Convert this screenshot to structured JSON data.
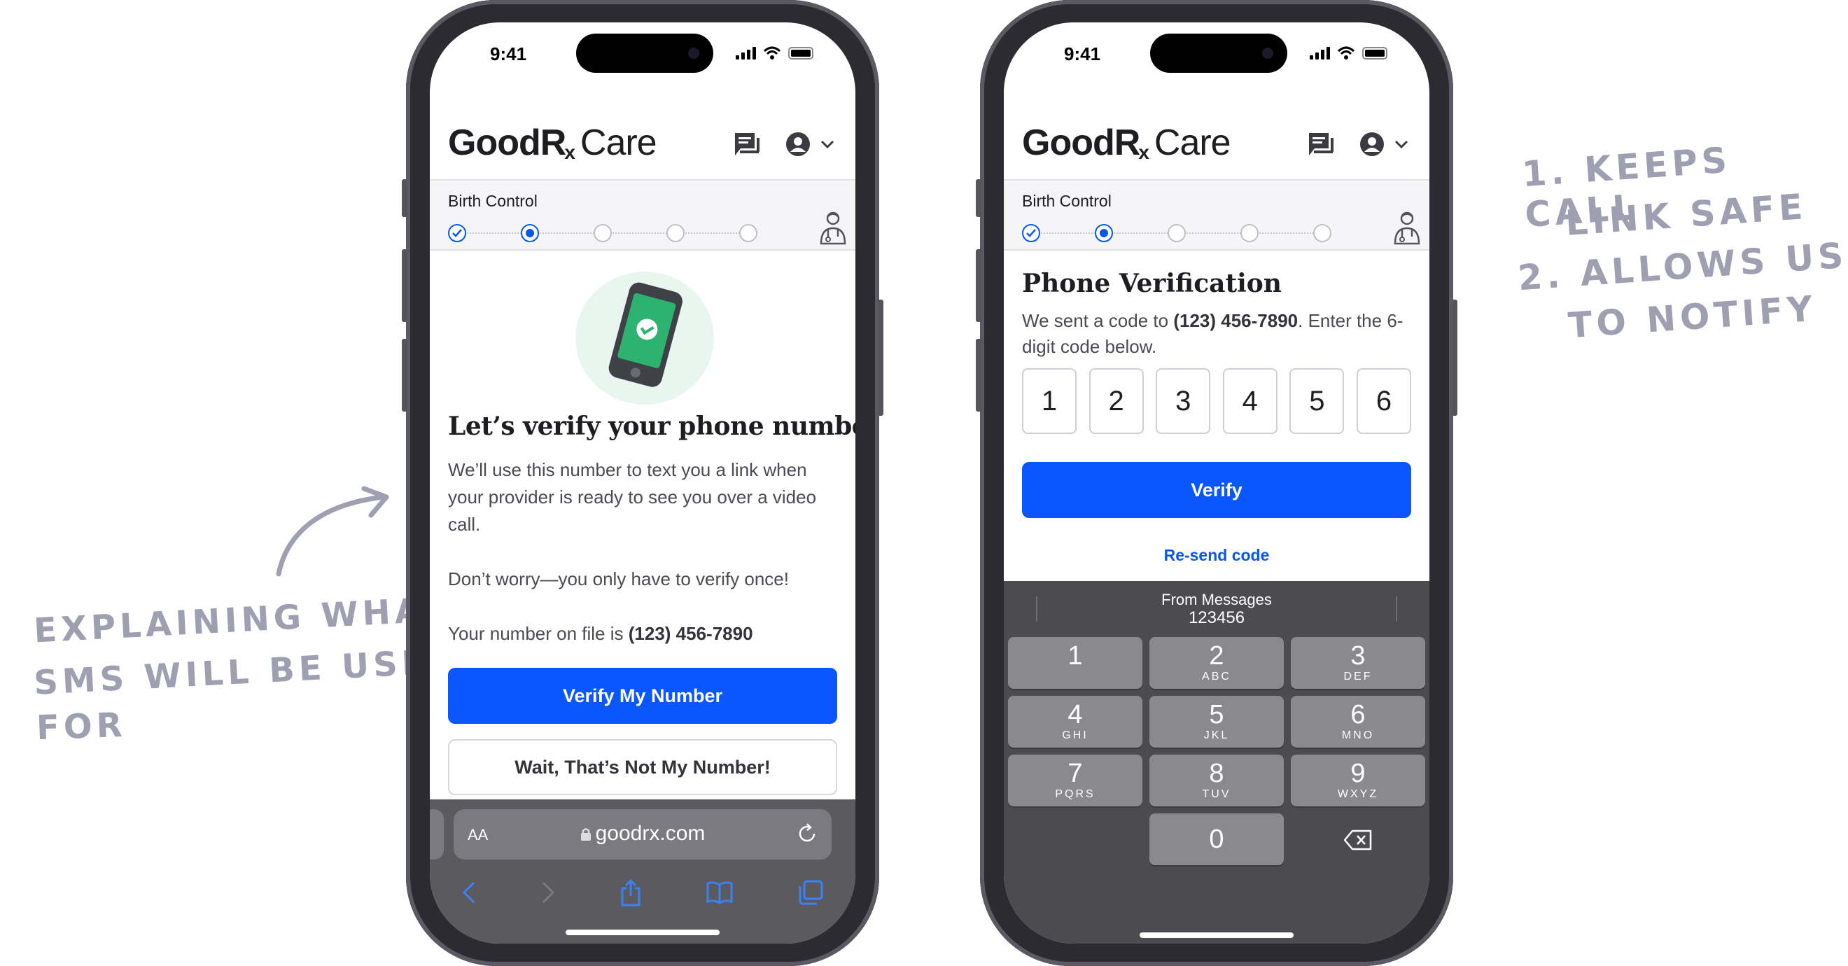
{
  "annotations": {
    "left": [
      "EXPLAINING WHAT",
      "SMS WILL BE USED",
      "FOR"
    ],
    "right": [
      "1. KEEPS CALL",
      "LINK SAFE",
      "2. ALLOWS US",
      "TO NOTIFY"
    ]
  },
  "status_bar": {
    "time": "9:41"
  },
  "header": {
    "brand_bold": "Good",
    "brand_rx": "Rx",
    "brand_sub": "x",
    "brand_care": "Care"
  },
  "progress": {
    "label": "Birth Control"
  },
  "left_phone": {
    "title": "Let’s verify your phone number",
    "paragraph_1": "We’ll use this number to text you a link when your provider is ready to see you over a video call.",
    "paragraph_2": "Don’t worry—you only have to verify once!",
    "number_prefix": "Your number on file is ",
    "number": "(123) 456-7890",
    "primary_button": "Verify My Number",
    "secondary_button": "Wait, That’s Not My Number!",
    "safari": {
      "aa": "AA",
      "url": "goodrx.com"
    }
  },
  "right_phone": {
    "title": "Phone Verification",
    "desc_prefix": "We sent a code to ",
    "desc_number": "(123) 456-7890",
    "desc_suffix": ". Enter the 6-digit code below.",
    "code": [
      "1",
      "2",
      "3",
      "4",
      "5",
      "6"
    ],
    "verify_button": "Verify",
    "resend_link": "Re-send code",
    "suggestion_source": "From Messages",
    "suggestion_code": "123456",
    "keypad": [
      {
        "digit": "1",
        "letters": ""
      },
      {
        "digit": "2",
        "letters": "ABC"
      },
      {
        "digit": "3",
        "letters": "DEF"
      },
      {
        "digit": "4",
        "letters": "GHI"
      },
      {
        "digit": "5",
        "letters": "JKL"
      },
      {
        "digit": "6",
        "letters": "MNO"
      },
      {
        "digit": "7",
        "letters": "PQRS"
      },
      {
        "digit": "8",
        "letters": "TUV"
      },
      {
        "digit": "9",
        "letters": "WXYZ"
      },
      {
        "digit": "0",
        "letters": ""
      }
    ]
  },
  "colors": {
    "accent": "#0a57ff",
    "annotation": "#9ea0b1",
    "keyboard": "#4c4c50"
  },
  "icons": [
    "chat-icon",
    "account-icon",
    "chevron-down-icon",
    "check-icon",
    "doctor-icon",
    "lock-icon",
    "reload-icon",
    "back-icon",
    "forward-icon",
    "share-icon",
    "bookmarks-icon",
    "tabs-icon",
    "delete-key-icon",
    "phone-check-illustration"
  ]
}
